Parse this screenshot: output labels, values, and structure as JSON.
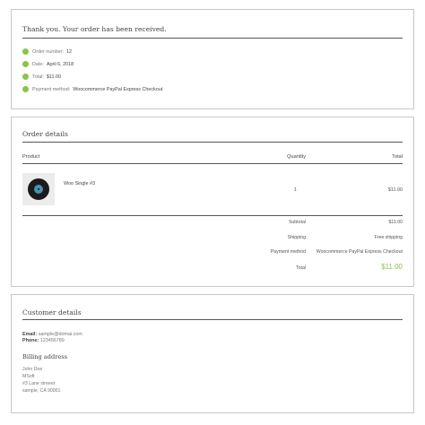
{
  "thankyou": {
    "title": "Thank you. Your order has been received.",
    "items": [
      {
        "label": "Order number:",
        "value": "12"
      },
      {
        "label": "Date:",
        "value": "April 6, 2018"
      },
      {
        "label": "Total:",
        "value": "$11.00"
      },
      {
        "label": "Payment method:",
        "value": "Woocommerce PayPal Express Checkout"
      }
    ]
  },
  "order": {
    "title": "Order details",
    "headers": {
      "product": "Product",
      "quantity": "Quantity",
      "total": "Total"
    },
    "item": {
      "name": "Woo Single #3",
      "quantity": "1",
      "total": "$11.00"
    },
    "totals": [
      {
        "label": "Subtotal",
        "value": "$11.00"
      },
      {
        "label": "Shipping",
        "value": "Free shipping"
      },
      {
        "label": "Payment method",
        "value": "Woocommerce PayPal Express Checkout"
      },
      {
        "label": "Total",
        "value": "$11.00"
      }
    ],
    "accent_color": "#8bc34a"
  },
  "customer": {
    "title": "Customer details",
    "email_label": "Email:",
    "email": "sample@domai.com",
    "phone_label": "Phone:",
    "phone": "123456789",
    "billing_title": "Billing address",
    "address": [
      "John Doe",
      "MSoft",
      "#3 Lane streeet",
      "sample, CA 90001"
    ]
  }
}
